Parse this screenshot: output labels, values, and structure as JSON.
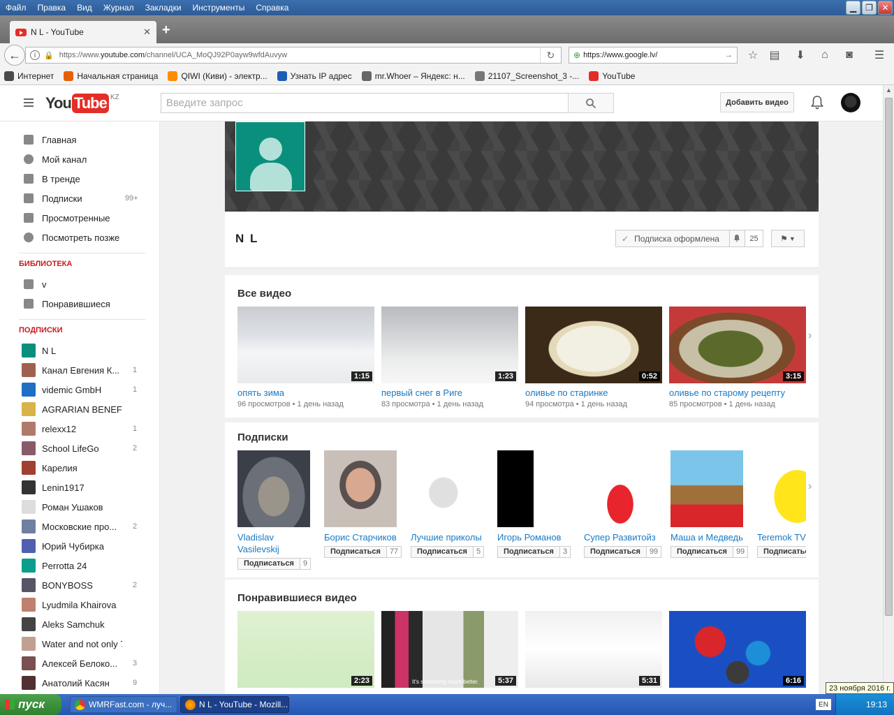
{
  "menubar": {
    "items": [
      "Файл",
      "Правка",
      "Вид",
      "Журнал",
      "Закладки",
      "Инструменты",
      "Справка"
    ]
  },
  "tab": {
    "title": "N L - YouTube"
  },
  "navbar": {
    "url_prefix": "https://www.",
    "url_host": "youtube.com",
    "url_path": "/channel/UCA_MoQJ92P0ayw9wfdAuvyw",
    "search_text": "https://www.google.lv/"
  },
  "bookmarks": [
    {
      "label": "Интернет",
      "color": "#4a4a4a"
    },
    {
      "label": "Начальная страница",
      "color": "#e66000"
    },
    {
      "label": "QIWI (Киви) - электр...",
      "color": "#ff8c00"
    },
    {
      "label": "Узнать IP адрес",
      "color": "#1c5db7"
    },
    {
      "label": "mr.Whoer – Яндекс: н...",
      "color": "#666666"
    },
    {
      "label": "21107_Screenshot_3 -...",
      "color": "#777777"
    },
    {
      "label": "YouTube",
      "color": "#e52d27"
    }
  ],
  "yt": {
    "logo_you": "You",
    "logo_tube": "Tube",
    "logo_region": "KZ",
    "search_placeholder": "Введите запрос",
    "upload_label": "Добавить видео"
  },
  "sidebar": {
    "nav": [
      {
        "label": "Главная",
        "icon": "home-icon",
        "count": ""
      },
      {
        "label": "Мой канал",
        "icon": "person-icon",
        "count": ""
      },
      {
        "label": "В тренде",
        "icon": "flame-icon",
        "count": ""
      },
      {
        "label": "Подписки",
        "icon": "subscriptions-icon",
        "count": "99+"
      },
      {
        "label": "Просмотренные",
        "icon": "hourglass-icon",
        "count": ""
      },
      {
        "label": "Посмотреть позже",
        "icon": "clock-icon",
        "count": ""
      }
    ],
    "library_title": "БИБЛИОТЕКА",
    "library": [
      {
        "label": "v",
        "icon": "playlist-icon"
      },
      {
        "label": "Понравившиеся",
        "icon": "thumbs-up-icon"
      }
    ],
    "subs_title": "ПОДПИСКИ",
    "subs": [
      {
        "label": "N L",
        "count": "",
        "color": "#0a8f7d"
      },
      {
        "label": "Канал Евгения К...",
        "count": "1",
        "color": "#a06050"
      },
      {
        "label": "videmic GmbH",
        "count": "1",
        "color": "#1f6fc5"
      },
      {
        "label": "AGRARIAN BENEFIT - ...",
        "count": "",
        "color": "#d9b34a"
      },
      {
        "label": "relexx12",
        "count": "1",
        "color": "#b07a6a"
      },
      {
        "label": "School LifeGo",
        "count": "2",
        "color": "#8a5a6a"
      },
      {
        "label": "Карелия",
        "count": "",
        "color": "#a04030"
      },
      {
        "label": "Lenin1917",
        "count": "",
        "color": "#333333"
      },
      {
        "label": "Роман Ушаков",
        "count": "",
        "color": "#dddddd"
      },
      {
        "label": "Московские про...",
        "count": "2",
        "color": "#7080a0"
      },
      {
        "label": "Юрий Чубирка",
        "count": "",
        "color": "#5060b0"
      },
      {
        "label": "Perrotta 24",
        "count": "",
        "color": "#0a9f8d"
      },
      {
        "label": "BONYBOSS",
        "count": "2",
        "color": "#555566"
      },
      {
        "label": "Lyudmila Khairova",
        "count": "",
        "color": "#c08070"
      },
      {
        "label": "Aleks Samchuk",
        "count": "",
        "color": "#444444"
      },
      {
        "label": "Water and not only 7",
        "count": "",
        "color": "#c0a090"
      },
      {
        "label": "Алексей Белоко...",
        "count": "3",
        "color": "#7a5050"
      },
      {
        "label": "Анатолий Касян",
        "count": "9",
        "color": "#503030"
      }
    ]
  },
  "channel": {
    "name": "N L",
    "subscribed_label": "Подписка оформлена",
    "subscriber_count": "25"
  },
  "shelves": {
    "all_videos": {
      "title": "Все видео",
      "videos": [
        {
          "title": "опять зима",
          "views": "96 просмотров",
          "age": "1 день назад",
          "duration": "1:15"
        },
        {
          "title": "первый снег в Риге",
          "views": "83 просмотра",
          "age": "1 день назад",
          "duration": "1:23"
        },
        {
          "title": "оливье по старинке",
          "views": "94 просмотра",
          "age": "1 день назад",
          "duration": "0:52"
        },
        {
          "title": "оливье по старому рецепту",
          "views": "85 просмотров",
          "age": "1 день назад",
          "duration": "3:15"
        }
      ]
    },
    "subscriptions": {
      "title": "Подписки",
      "subscribe_label": "Подписаться",
      "channels": [
        {
          "name": "Vladislav Vasilevskij",
          "count": "9"
        },
        {
          "name": "Борис Старчиков",
          "count": "77"
        },
        {
          "name": "Лучшие приколы",
          "count": "5"
        },
        {
          "name": "Игорь Романов",
          "count": "3"
        },
        {
          "name": "Супер Развитойз",
          "count": "99"
        },
        {
          "name": "Маша и Медведь",
          "count": "99"
        },
        {
          "name": "Teremok TV",
          "count": ""
        }
      ]
    },
    "liked": {
      "title": "Понравившиеся видео",
      "videos": [
        {
          "duration": "2:23"
        },
        {
          "duration": "5:37",
          "caption": "It's something much better."
        },
        {
          "duration": "5:31"
        },
        {
          "duration": "6:16"
        }
      ]
    }
  },
  "taskbar": {
    "start_label": "пуск",
    "tasks": [
      "WMRFast.com - луч...",
      "N L - YouTube - Mozill..."
    ],
    "lang": "EN",
    "time": "19:13",
    "date_tooltip": "23 ноября 2016 г."
  }
}
